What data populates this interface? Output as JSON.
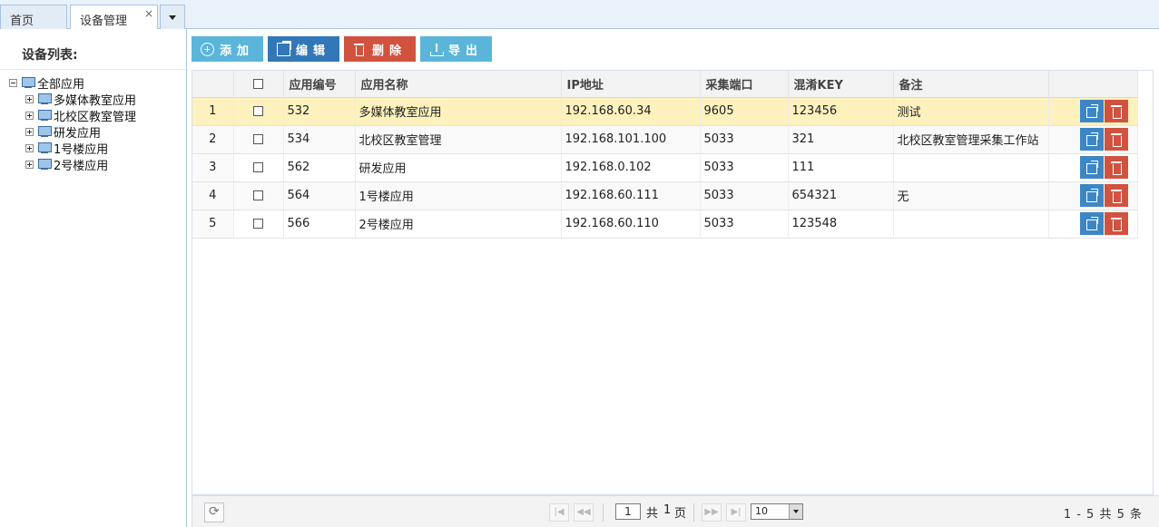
{
  "tabs": [
    {
      "label": "首页",
      "active": false
    },
    {
      "label": "设备管理",
      "active": true,
      "close": "×"
    }
  ],
  "sidebar": {
    "title": "设备列表:",
    "root": "全部应用",
    "children": [
      "多媒体教室应用",
      "北校区教室管理",
      "研发应用",
      "1号楼应用",
      "2号楼应用"
    ]
  },
  "toolbar": {
    "add": "添加",
    "edit": "编辑",
    "delete": "删除",
    "export": "导出"
  },
  "table": {
    "columns": [
      "应用编号",
      "应用名称",
      "IP地址",
      "采集端口",
      "混淆KEY",
      "备注"
    ],
    "rows": [
      {
        "n": "1",
        "id": "532",
        "name": "多媒体教室应用",
        "ip": "192.168.60.34",
        "port": "9605",
        "key": "123456",
        "note": "测试"
      },
      {
        "n": "2",
        "id": "534",
        "name": "北校区教室管理",
        "ip": "192.168.101.100",
        "port": "5033",
        "key": "321",
        "note": "北校区教室管理采集工作站"
      },
      {
        "n": "3",
        "id": "562",
        "name": "研发应用",
        "ip": "192.168.0.102",
        "port": "5033",
        "key": "111",
        "note": ""
      },
      {
        "n": "4",
        "id": "564",
        "name": "1号楼应用",
        "ip": "192.168.60.111",
        "port": "5033",
        "key": "654321",
        "note": "无"
      },
      {
        "n": "5",
        "id": "566",
        "name": "2号楼应用",
        "ip": "192.168.60.110",
        "port": "5033",
        "key": "123548",
        "note": ""
      }
    ]
  },
  "pager": {
    "page": "1",
    "total_prefix": "共",
    "total_pages": "1",
    "total_suffix": "页",
    "page_size": "10",
    "info": "1 - 5  共 5 条"
  }
}
